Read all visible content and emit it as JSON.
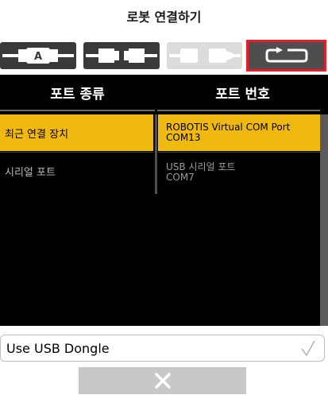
{
  "title": "로봇 연결하기",
  "connection_tabs": [
    {
      "icon": "cable-a-icon",
      "label": "A",
      "selected": false
    },
    {
      "icon": "cable-serial-icon",
      "selected": false
    },
    {
      "icon": "cable-usb-icon",
      "selected": false
    },
    {
      "icon": "reconnect-arrow-icon",
      "selected": true
    }
  ],
  "columns": {
    "port_type": "포트 종류",
    "port_number": "포트 번호"
  },
  "port_types": [
    {
      "label": "최근 연결 장치",
      "selected": true
    },
    {
      "label": "시리얼 포트",
      "selected": false
    }
  ],
  "ports": [
    {
      "name": "ROBOTIS Virtual COM Port",
      "port": "COM13",
      "selected": true
    },
    {
      "name": "USB 시리얼 포트",
      "port": "COM7",
      "selected": false
    }
  ],
  "dongle": {
    "label": "Use USB Dongle",
    "checked": false
  },
  "colors": {
    "selected": "#f0b90f",
    "active_tab_border": "#e4202a",
    "panel_bg": "#000000"
  }
}
